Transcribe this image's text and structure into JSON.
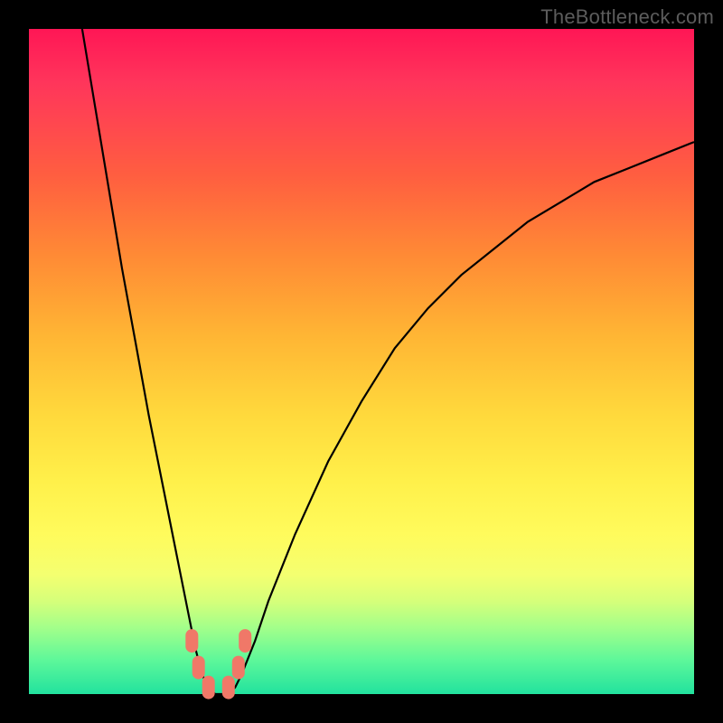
{
  "watermark": "TheBottleneck.com",
  "chart_data": {
    "type": "line",
    "title": "",
    "xlabel": "",
    "ylabel": "",
    "xlim": [
      0,
      100
    ],
    "ylim": [
      0,
      100
    ],
    "series": [
      {
        "name": "curve",
        "x": [
          8,
          10,
          12,
          14,
          16,
          18,
          20,
          22,
          24,
          25,
          26,
          27,
          28,
          29,
          30,
          31,
          32,
          34,
          36,
          40,
          45,
          50,
          55,
          60,
          65,
          70,
          75,
          80,
          85,
          90,
          95,
          100
        ],
        "values": [
          100,
          88,
          76,
          64,
          53,
          42,
          32,
          22,
          12,
          7,
          3,
          1,
          0,
          0,
          0,
          1,
          3,
          8,
          14,
          24,
          35,
          44,
          52,
          58,
          63,
          67,
          71,
          74,
          77,
          79,
          81,
          83
        ]
      }
    ],
    "markers": [
      {
        "x": 24.5,
        "y": 8
      },
      {
        "x": 25.5,
        "y": 4
      },
      {
        "x": 27.0,
        "y": 1
      },
      {
        "x": 30.0,
        "y": 1
      },
      {
        "x": 31.5,
        "y": 4
      },
      {
        "x": 32.5,
        "y": 8
      }
    ],
    "marker_color": "#f07868",
    "curve_color": "#000000",
    "background_gradient": [
      "#ff1655",
      "#ff8a35",
      "#fff04a",
      "#22e29e"
    ]
  }
}
